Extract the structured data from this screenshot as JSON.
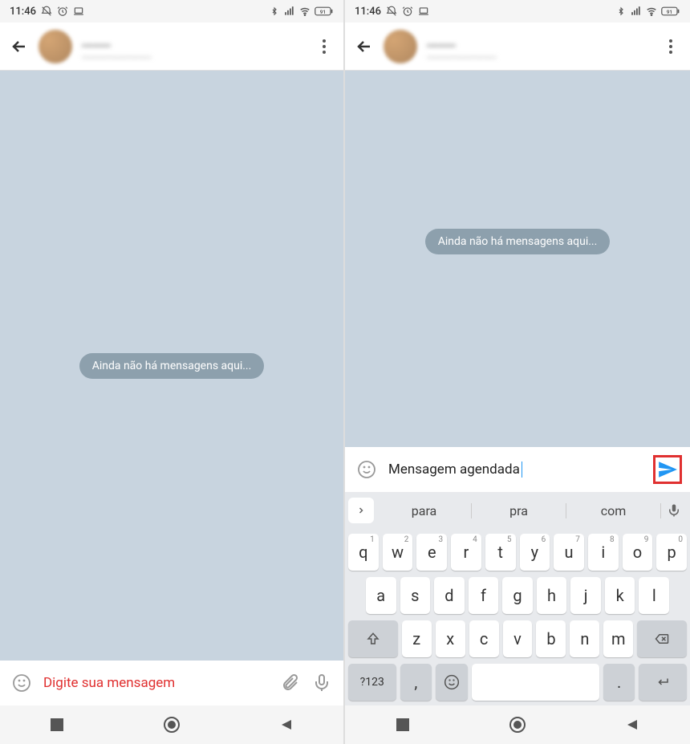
{
  "status": {
    "time": "11:46",
    "battery": "91"
  },
  "contact": {
    "name": "_____",
    "status": "________________"
  },
  "chat": {
    "empty_message": "Ainda não há mensagens aqui..."
  },
  "left": {
    "input_placeholder": "Digite sua mensagem"
  },
  "right": {
    "input_value": "Mensagem agendada",
    "suggestions": [
      "para",
      "pra",
      "com"
    ]
  },
  "keyboard": {
    "row1": [
      {
        "k": "q",
        "s": "1"
      },
      {
        "k": "w",
        "s": "2"
      },
      {
        "k": "e",
        "s": "3"
      },
      {
        "k": "r",
        "s": "4"
      },
      {
        "k": "t",
        "s": "5"
      },
      {
        "k": "y",
        "s": "6"
      },
      {
        "k": "u",
        "s": "7"
      },
      {
        "k": "i",
        "s": "8"
      },
      {
        "k": "o",
        "s": "9"
      },
      {
        "k": "p",
        "s": "0"
      }
    ],
    "row2": [
      "a",
      "s",
      "d",
      "f",
      "g",
      "h",
      "j",
      "k",
      "l"
    ],
    "row3": [
      "z",
      "x",
      "c",
      "v",
      "b",
      "n",
      "m"
    ],
    "symbols_key": "?123",
    "comma_key": ",",
    "period_key": "."
  }
}
